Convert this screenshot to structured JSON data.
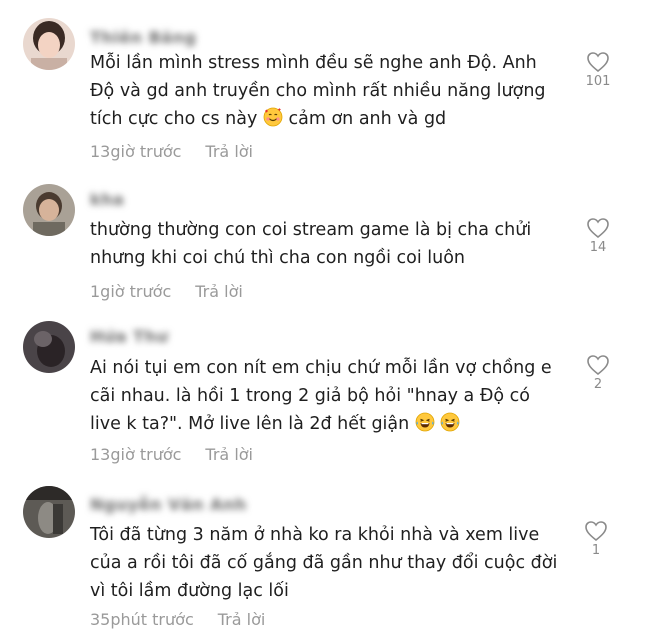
{
  "comments": [
    {
      "username": "Thiên Băng",
      "lines": [
        "Mỗi lần mình stress mình đều sẽ nghe anh Độ. Anh",
        "Độ và gd anh truyền cho mình rất nhiều năng lượng",
        "tích cực cho cs này",
        "cảm ơn anh và gd"
      ],
      "time": "13giờ trước",
      "reply": "Trả lời",
      "likes": "101",
      "emoji": "smiling-face-with-hearts"
    },
    {
      "username": "kha",
      "lines": [
        "thường thường con coi stream game là bị cha chửi",
        "nhưng khi coi chú thì cha con ngồi coi luôn"
      ],
      "time": "1giờ trước",
      "reply": "Trả lời",
      "likes": "14"
    },
    {
      "username": "Hứa Thư",
      "lines": [
        "Ai nói tụi em con nít em chịu chứ mỗi lần vợ chồng e",
        "cãi nhau. là hồi 1 trong 2 giả bộ hỏi \"hnay a Độ có",
        "live k ta?\". Mở live lên là 2đ hết giận"
      ],
      "time": "13giờ trước",
      "reply": "Trả lời",
      "likes": "2",
      "emoji": "grinning-squinting-tears"
    },
    {
      "username": "Nguyễn Văn Anh",
      "lines": [
        "Tôi đã từng 3 năm ở nhà ko ra khỏi nhà và xem live",
        "của a rồi tôi đã cố gắng đã gần như thay đổi cuộc đời",
        "vì tôi lầm đường lạc lối"
      ],
      "time": "35phút trước",
      "reply": "Trả lời",
      "likes": "1"
    }
  ],
  "colors": {
    "text": "#1f1f1f",
    "meta": "#9a9a9a",
    "heart": "#8a8a8a"
  }
}
